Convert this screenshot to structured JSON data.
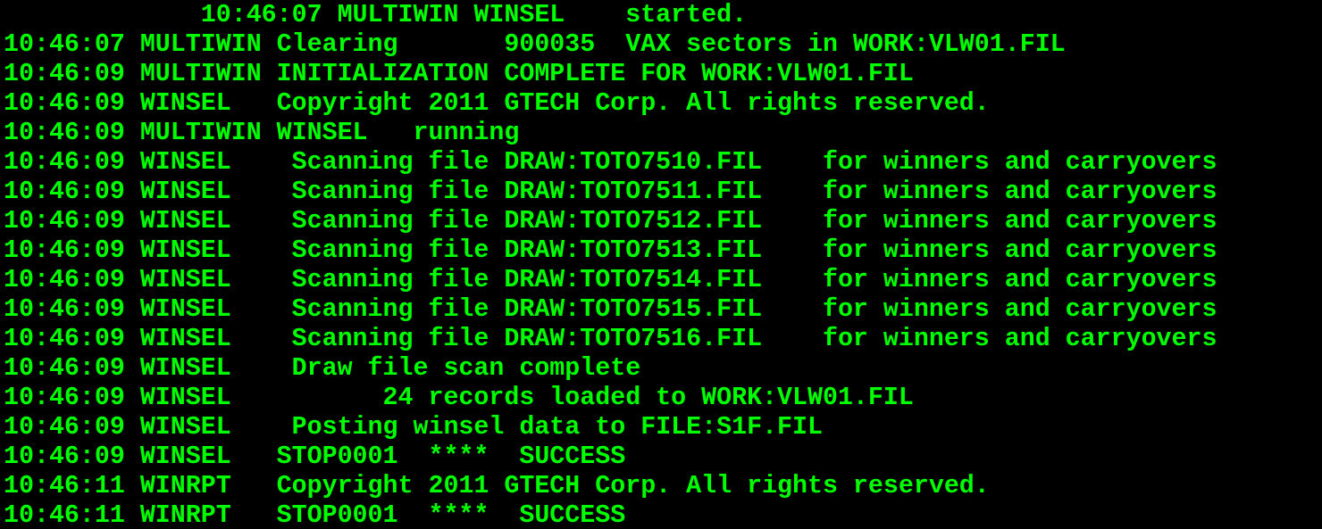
{
  "terminal": {
    "text_color": "#00ff00",
    "background_color": "#000000",
    "lines": [
      "             10:46:07 MULTIWIN WINSEL    started.",
      "10:46:07 MULTIWIN Clearing       900035  VAX sectors in WORK:VLW01.FIL",
      "10:46:09 MULTIWIN INITIALIZATION COMPLETE FOR WORK:VLW01.FIL",
      "10:46:09 WINSEL   Copyright 2011 GTECH Corp. All rights reserved.",
      "10:46:09 MULTIWIN WINSEL   running",
      "10:46:09 WINSEL    Scanning file DRAW:TOTO7510.FIL    for winners and carryovers",
      "10:46:09 WINSEL    Scanning file DRAW:TOTO7511.FIL    for winners and carryovers",
      "10:46:09 WINSEL    Scanning file DRAW:TOTO7512.FIL    for winners and carryovers",
      "10:46:09 WINSEL    Scanning file DRAW:TOTO7513.FIL    for winners and carryovers",
      "10:46:09 WINSEL    Scanning file DRAW:TOTO7514.FIL    for winners and carryovers",
      "10:46:09 WINSEL    Scanning file DRAW:TOTO7515.FIL    for winners and carryovers",
      "10:46:09 WINSEL    Scanning file DRAW:TOTO7516.FIL    for winners and carryovers",
      "10:46:09 WINSEL    Draw file scan complete",
      "10:46:09 WINSEL          24 records loaded to WORK:VLW01.FIL",
      "10:46:09 WINSEL    Posting winsel data to FILE:S1F.FIL",
      "10:46:09 WINSEL   STOP0001  ****  SUCCESS",
      "10:46:11 WINRPT   Copyright 2011 GTECH Corp. All rights reserved.",
      "10:46:11 WINRPT   STOP0001  ****  SUCCESS"
    ]
  }
}
